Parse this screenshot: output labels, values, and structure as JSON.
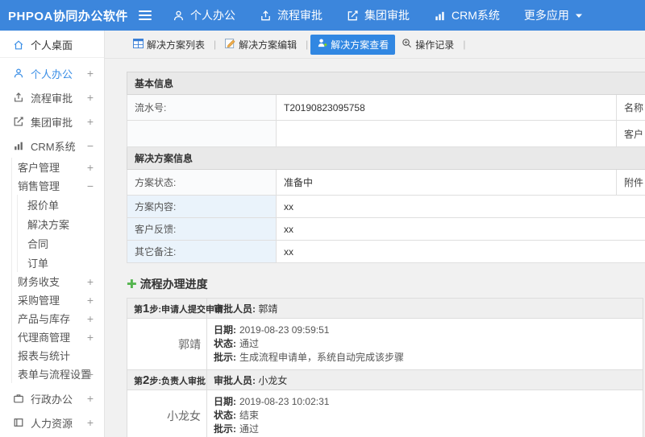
{
  "topbar": {
    "logo": "PHPOA协同办公软件",
    "nav": [
      {
        "label": "个人办公"
      },
      {
        "label": "流程审批"
      },
      {
        "label": "集团审批"
      },
      {
        "label": "CRM系统"
      },
      {
        "label": "更多应用"
      }
    ]
  },
  "sidebar": {
    "items": [
      {
        "label": "个人桌面",
        "expander": ""
      },
      {
        "label": "个人办公",
        "expander": "+"
      },
      {
        "label": "流程审批",
        "expander": "+"
      },
      {
        "label": "集团审批",
        "expander": "+"
      },
      {
        "label": "CRM系统",
        "expander": "−"
      },
      {
        "label": "客户管理",
        "expander": "+"
      },
      {
        "label": "销售管理",
        "expander": "−"
      },
      {
        "label": "报价单",
        "expander": ""
      },
      {
        "label": "解决方案",
        "expander": ""
      },
      {
        "label": "合同",
        "expander": ""
      },
      {
        "label": "订单",
        "expander": ""
      },
      {
        "label": "财务收支",
        "expander": "+"
      },
      {
        "label": "采购管理",
        "expander": "+"
      },
      {
        "label": "产品与库存",
        "expander": "+"
      },
      {
        "label": "代理商管理",
        "expander": "+"
      },
      {
        "label": "报表与统计",
        "expander": ""
      },
      {
        "label": "表单与流程设置",
        "expander": "+"
      },
      {
        "label": "行政办公",
        "expander": "+"
      },
      {
        "label": "人力资源",
        "expander": "+"
      }
    ]
  },
  "tabs": [
    {
      "label": "解决方案列表"
    },
    {
      "label": "解决方案编辑"
    },
    {
      "label": "解决方案查看"
    },
    {
      "label": "操作记录"
    }
  ],
  "form": {
    "section1_title": "基本信息",
    "serial_label": "流水号:",
    "serial_value": "T20190823095758",
    "name_label": "名称",
    "customer_label": "客户",
    "section2_title": "解决方案信息",
    "status_label": "方案状态:",
    "status_value": "准备中",
    "attachment_label": "附件",
    "content_label": "方案内容:",
    "content_value": "xx",
    "feedback_label": "客户反馈:",
    "feedback_value": "xx",
    "remark_label": "其它备注:",
    "remark_value": "xx"
  },
  "progress": {
    "title": "流程办理进度",
    "approver_label": "审批人员:",
    "date_label": "日期:",
    "status_label": "状态:",
    "comment_label": "批示:",
    "steps": [
      {
        "pre": "第",
        "num": "1",
        "post": "步:申请人提交申请",
        "approver": "郭靖",
        "name": "郭靖",
        "date": "2019-08-23 09:59:51",
        "status": "通过",
        "comment": "生成流程申请单，系统自动完成该步骤"
      },
      {
        "pre": "第",
        "num": "2",
        "post": "步:负责人审批",
        "approver": "小龙女",
        "name": "小龙女",
        "date": "2019-08-23 10:02:31",
        "status": "结束",
        "comment": "通过"
      }
    ]
  },
  "colors": {
    "topbar_blue": "#3c86dc",
    "active_tab_blue": "#3187e2",
    "link_blue": "#3a8ee6",
    "label_blue_bg": "#eaf3fb",
    "green_plus": "#55b54f"
  }
}
